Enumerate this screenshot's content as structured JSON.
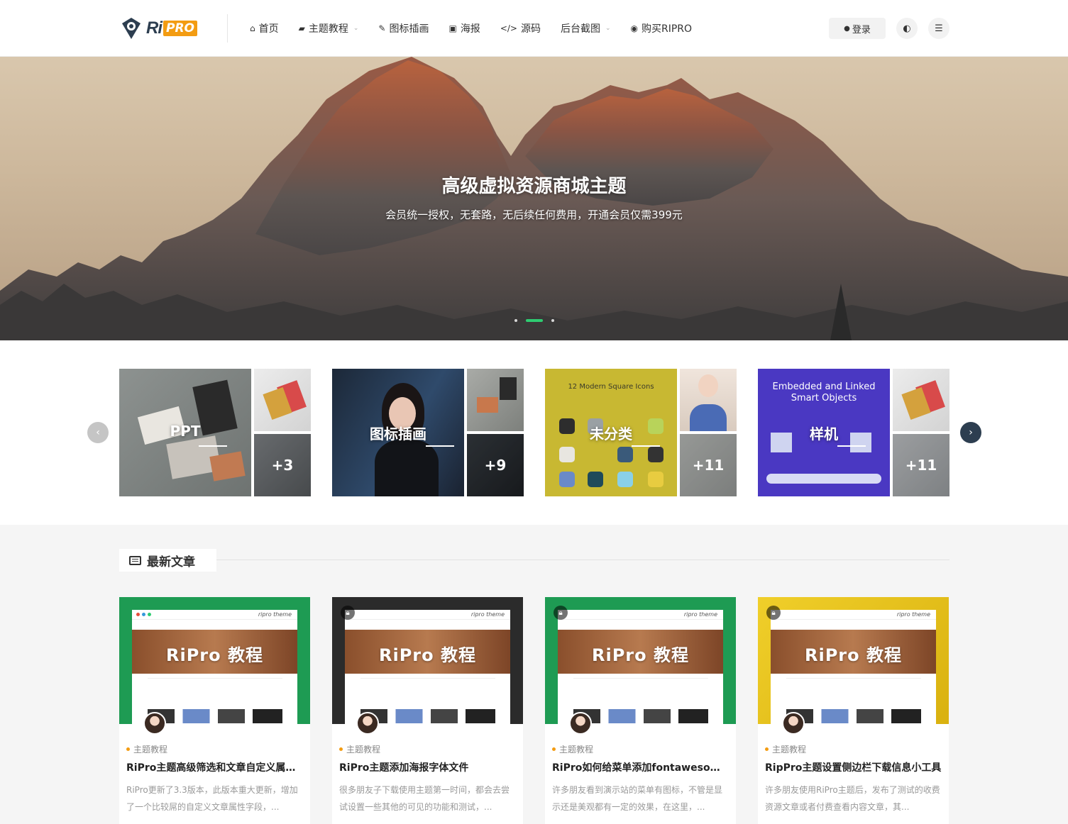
{
  "header": {
    "logo": {
      "text": "Ri",
      "badge": "PRO"
    },
    "nav": [
      {
        "label": "首页",
        "icon": "home-icon",
        "glyph": "⌂",
        "dropdown": false
      },
      {
        "label": "主题教程",
        "icon": "graduation-cap-icon",
        "glyph": "▰",
        "dropdown": true
      },
      {
        "label": "图标插画",
        "icon": "brush-icon",
        "glyph": "✎",
        "dropdown": false
      },
      {
        "label": "海报",
        "icon": "image-icon",
        "glyph": "▣",
        "dropdown": false
      },
      {
        "label": "源码",
        "icon": "code-icon",
        "glyph": "</>",
        "dropdown": false
      },
      {
        "label": "后台截图",
        "icon": "",
        "glyph": "",
        "dropdown": true
      },
      {
        "label": "购买RIPRO",
        "icon": "target-icon",
        "glyph": "◉",
        "dropdown": false
      }
    ],
    "login_label": "登录",
    "theme_toggle_glyph": "◐",
    "menu_glyph": "☰"
  },
  "hero": {
    "title": "高级虚拟资源商城主题",
    "subtitle": "会员统一授权，无套路，无后续任何费用，开通会员仅需399元",
    "slides": 3,
    "active_slide": 2
  },
  "categories": [
    {
      "label": "PPT",
      "more": "+3"
    },
    {
      "label": "图标插画",
      "more": "+9"
    },
    {
      "label": "未分类",
      "more": "+11"
    },
    {
      "label": "样机",
      "more": "+11"
    }
  ],
  "latest": {
    "section_title": "最新文章",
    "thumb_title": "RiPro 教程",
    "thumb_brand": "ripro theme",
    "posts": [
      {
        "category": "主题教程",
        "title": "RiPro主题高级筛选和文章自定义属性字段",
        "excerpt": "RiPro更新了3.3版本，此版本重大更新，增加了一个比较屌的自定义文章属性字段，...",
        "frame_color": "#1e9b53",
        "locked": false
      },
      {
        "category": "主题教程",
        "title": "RiPro主题添加海报字体文件",
        "excerpt": "很多朋友子下载使用主题第一时间，都会去尝试设置一些其他的可见的功能和测试，...",
        "frame_color": "#2b2b2b",
        "locked": true
      },
      {
        "category": "主题教程",
        "title": "RiPro如何给菜单添加fontawesome图标",
        "excerpt": "许多朋友看到演示站的菜单有图标，不管是显示还是美观都有一定的效果，在这里，...",
        "frame_color": "#1e9b53",
        "locked": true
      },
      {
        "category": "主题教程",
        "title": "RipPro主题设置侧边栏下载信息小工具",
        "excerpt": "许多朋友使用RiPro主题后，发布了测试的收费资源文章或者付费查看内容文章，其...",
        "frame_color": "#e8c21a",
        "locked": true
      }
    ]
  },
  "colors": {
    "accent": "#f39c12",
    "dark": "#2d3e50",
    "green": "#2ecc71"
  }
}
